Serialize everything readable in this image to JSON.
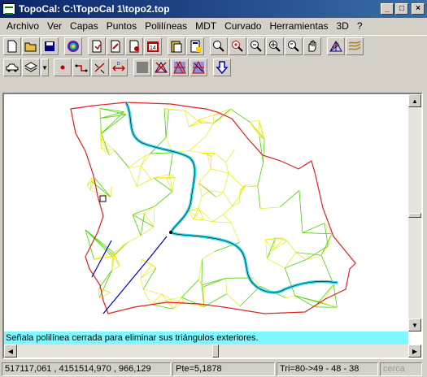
{
  "window": {
    "title": "TopoCal: C:\\TopoCal 1\\topo2.top",
    "min_glyph": "_",
    "max_glyph": "□",
    "close_glyph": "×"
  },
  "menu": [
    "Archivo",
    "Ver",
    "Capas",
    "Puntos",
    "Polilíneas",
    "MDT",
    "Curvado",
    "Herramientas",
    "3D",
    "?"
  ],
  "toolbar1": {
    "icons": [
      "new-file-icon",
      "open-folder-icon",
      "save-disk-icon",
      "spiral-icon",
      "import-points-icon",
      "edit-points-icon",
      "grid-points-icon",
      "calendar-14-icon",
      "paste-icon",
      "report-icon",
      "zoom-window-icon",
      "zoom-in-icon",
      "zoom-out-icon",
      "zoom-all-icon",
      "zoom-previous-icon",
      "pan-hand-icon",
      "triangulate-icon",
      "contour-icon"
    ]
  },
  "toolbar2": {
    "icons": [
      "car-icon",
      "layers-icon",
      "point-icon",
      "polyline-icon",
      "measure-icon",
      "distance-icon",
      "gray-square-icon",
      "delete-triangle-icon",
      "triangle-mesh-icon",
      "triangle-mesh-edit-icon",
      "down-arrow-icon"
    ]
  },
  "message": "Señala polilínea cerrada para eliminar sus triángulos exteriores.",
  "status": {
    "coords": "517117,061 , 4151514,970 , 966,129",
    "pte": "Pte=5,1878",
    "tri": "Tri=80->49 - 48 - 38",
    "mode": "cerca"
  },
  "colors": {
    "title_start": "#0a246a",
    "title_end": "#3a6ea5",
    "message_bg": "#80f8ff",
    "mesh_green": "#4ad400",
    "mesh_yellow": "#e6e600",
    "boundary_red": "#e02020",
    "river_cyan": "#30d8e8",
    "polyline_blue": "#0000c0"
  }
}
